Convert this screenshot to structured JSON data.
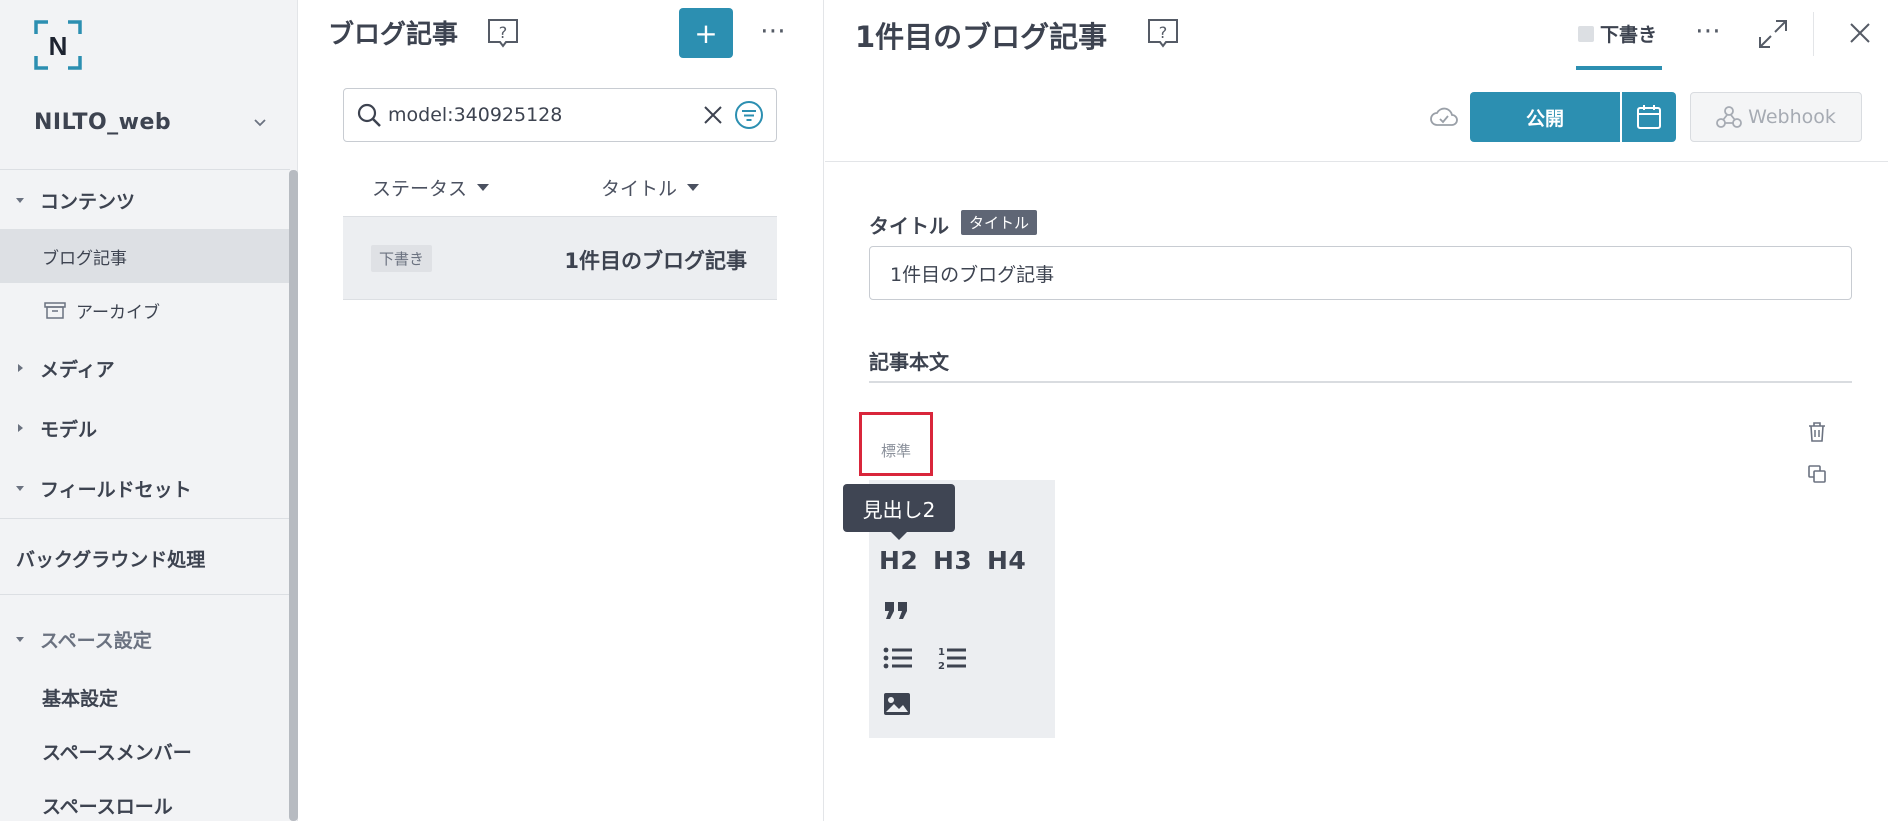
{
  "sidebar": {
    "space_name": "NILTO_web",
    "groups": {
      "contents": "コンテンツ",
      "media": "メディア",
      "model": "モデル",
      "fieldset": "フィールドセット",
      "background": "バックグラウンド処理",
      "space_settings": "スペース設定"
    },
    "items": {
      "blog": "ブログ記事",
      "archive": "アーカイブ",
      "basic": "基本設定",
      "members": "スペースメンバー",
      "roles": "スペースロール"
    }
  },
  "list": {
    "title": "ブログ記事",
    "add_label": "+",
    "search_value": "model:340925128",
    "columns": {
      "status": "ステータス",
      "title": "タイトル"
    },
    "rows": [
      {
        "status": "下書き",
        "title": "1件目のブログ記事"
      }
    ]
  },
  "detail": {
    "title": "1件目のブログ記事",
    "status_tab": "下書き",
    "publish_label": "公開",
    "webhook_label": "Webhook",
    "field_title_label": "タイトル",
    "field_title_tag": "タイトル",
    "field_title_value": "1件目のブログ記事",
    "body_label": "記事本文",
    "block_type": "標準",
    "tooltip": "見出し2",
    "toolbar": {
      "h2": "H2",
      "h3": "H3",
      "h4": "H4"
    }
  },
  "colors": {
    "accent": "#2c8fb1",
    "highlight": "#d9263b",
    "tooltip_bg": "#3f4553"
  }
}
